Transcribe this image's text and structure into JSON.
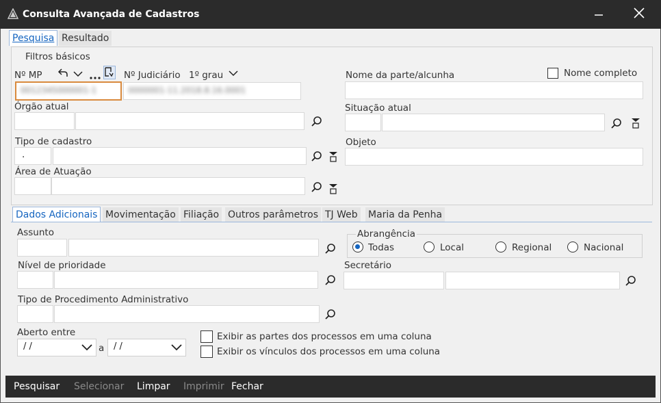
{
  "window": {
    "title": "Consulta Avançada de Cadastros"
  },
  "tabs": {
    "pesquisa": "Pesquisa",
    "resultado": "Resultado"
  },
  "filtros": {
    "group_title": "Filtros básicos",
    "nmp_label": "Nº MP",
    "nmp_value": "0012345000001-1",
    "judicial_label": "Nº Judiciário",
    "grau_label": "1º grau",
    "judicial_value": "0000001-11.2018.8.16.0001",
    "nome_parte_label": "Nome da parte/alcunha",
    "nome_completo_label": "Nome completo",
    "orgao_label": "Órgão atual",
    "situacao_label": "Situação atual",
    "tipo_cadastro_label": "Tipo de cadastro",
    "tipo_cadastro_code": ".",
    "objeto_label": "Objeto",
    "area_label": "Área de Atuação"
  },
  "subtabs": [
    "Dados Adicionais",
    "Movimentação",
    "Filiação",
    "Outros parâmetros",
    "TJ Web",
    "Maria da Penha"
  ],
  "adicionais": {
    "assunto_label": "Assunto",
    "abrangencia_label": "Abrangência",
    "radio_options": [
      "Todas",
      "Local",
      "Regional",
      "Nacional"
    ],
    "radio_selected": "Todas",
    "prioridade_label": "Nível de prioridade",
    "secretario_label": "Secretário",
    "tipo_proc_label": "Tipo de Procedimento Administrativo",
    "aberto_label": "Aberto entre",
    "date_from": " /  /",
    "date_sep": "a",
    "date_to": " /  /",
    "chk_partes": "Exibir as partes dos processos em uma coluna",
    "chk_vinculos": "Exibir os vínculos dos processos em uma coluna"
  },
  "toolbar": {
    "pesquisar": "Pesquisar",
    "selecionar": "Selecionar",
    "limpar": "Limpar",
    "imprimir": "Imprimir",
    "fechar": "Fechar"
  },
  "colors": {
    "accent": "#1565c0",
    "titlebar": "#2b2b2b",
    "focus": "#d98a3d"
  }
}
